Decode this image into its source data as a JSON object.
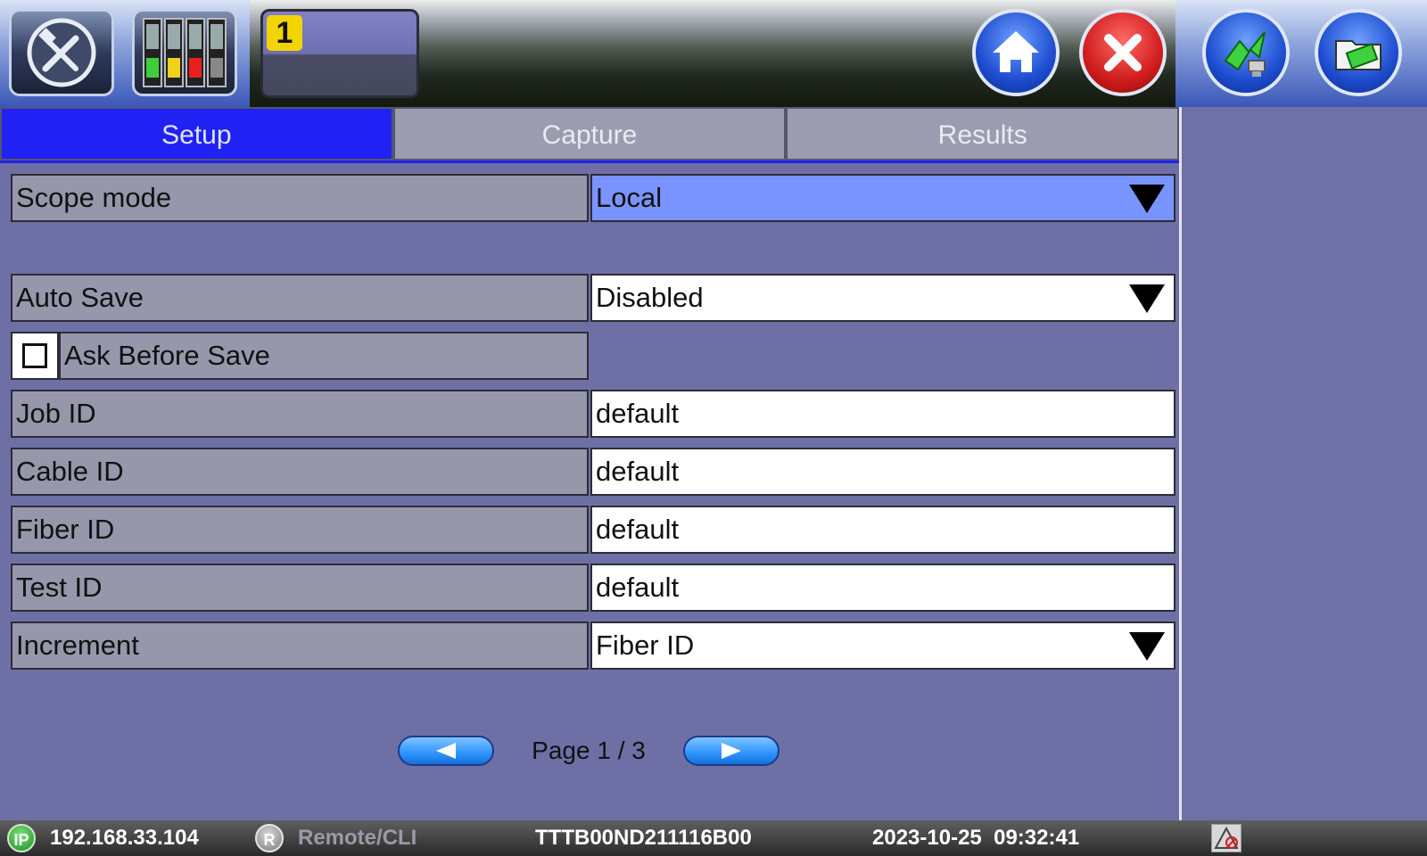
{
  "header": {
    "test_number": "1",
    "toolbar_icons": [
      "tools-icon",
      "test-modules-icon",
      "home-icon",
      "close-icon",
      "remote-connect-icon",
      "file-manager-icon"
    ]
  },
  "tabs": [
    {
      "label": "Setup",
      "active": true
    },
    {
      "label": "Capture",
      "active": false
    },
    {
      "label": "Results",
      "active": false
    }
  ],
  "form": {
    "scope_mode": {
      "label": "Scope mode",
      "value": "Local"
    },
    "auto_save": {
      "label": "Auto Save",
      "value": "Disabled"
    },
    "ask_before_save": {
      "label": "Ask Before Save",
      "checked": false
    },
    "job_id": {
      "label": "Job ID",
      "value": "default"
    },
    "cable_id": {
      "label": "Cable ID",
      "value": "default"
    },
    "fiber_id": {
      "label": "Fiber ID",
      "value": "default"
    },
    "test_id": {
      "label": "Test ID",
      "value": "default"
    },
    "increment": {
      "label": "Increment",
      "value": "Fiber ID"
    }
  },
  "pager": {
    "label": "Page 1 / 3"
  },
  "status": {
    "ip_badge": "IP",
    "ip": "192.168.33.104",
    "remote_badge": "R",
    "remote": "Remote/CLI",
    "serial": "TTTB00ND211116B00",
    "datetime": "2023-10-25  09:32:41"
  },
  "colors": {
    "accent_tab": "#1f22f2",
    "highlight_field": "#7a94ff",
    "panel_bg": "#6e70a5"
  }
}
